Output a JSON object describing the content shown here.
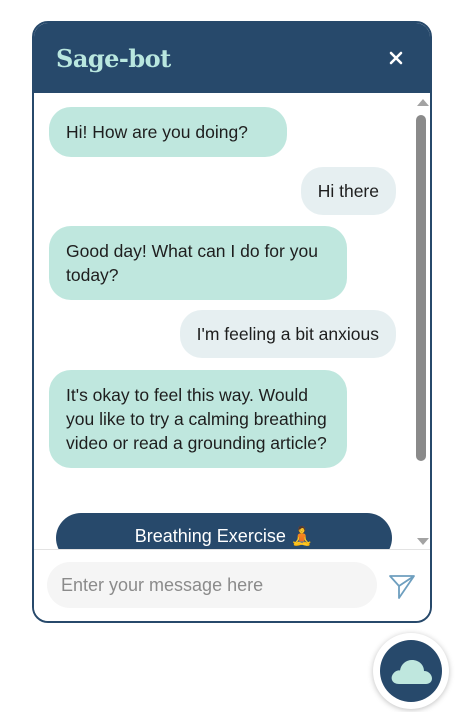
{
  "header": {
    "title": "Sage-bot",
    "close_icon": "close-icon"
  },
  "messages": [
    {
      "sender": "bot",
      "text": "Hi! How are you doing?"
    },
    {
      "sender": "user",
      "text": "Hi there"
    },
    {
      "sender": "bot",
      "text": "Good day! What can I do for you today?"
    },
    {
      "sender": "user",
      "text": "I'm feeling a bit anxious"
    },
    {
      "sender": "bot",
      "text": "It's okay to feel this way. Would you like to try a calming breathing video or read a grounding article?"
    }
  ],
  "quick_reply": {
    "label": "Breathing Exercise 🧘",
    "icon": "meditation-emoji"
  },
  "input": {
    "placeholder": "Enter your message here",
    "value": ""
  },
  "send_icon": "paper-plane-icon",
  "launcher_icon": "cloud-icon",
  "colors": {
    "header_bg": "#27496b",
    "title": "#b9e7df",
    "bot_bubble": "#bfe7de",
    "user_bubble": "#e6eff1",
    "button_bg": "#27496b"
  }
}
